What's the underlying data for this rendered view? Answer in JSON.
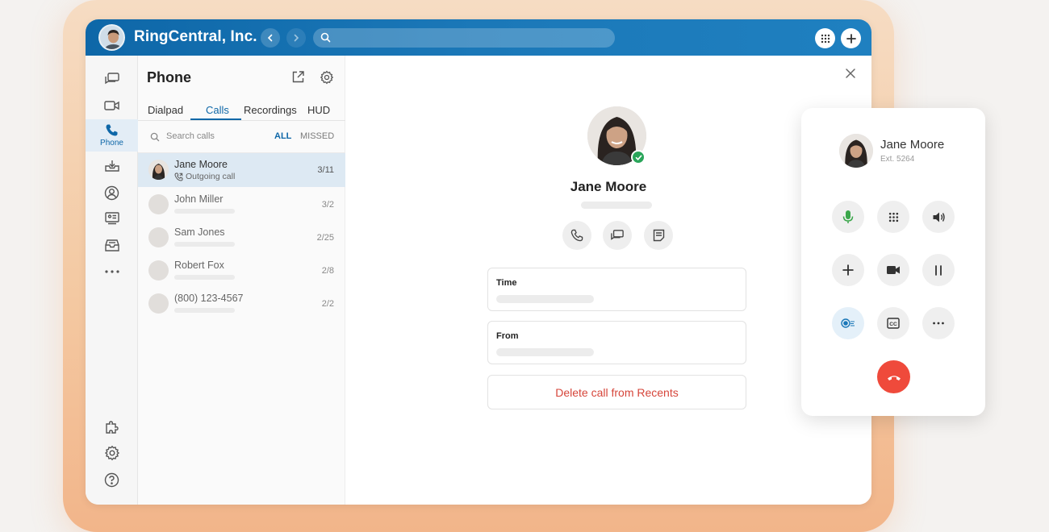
{
  "header": {
    "org_name": "RingCentral, Inc.",
    "search_placeholder": ""
  },
  "rail": {
    "items": [
      {
        "icon": "messages-icon"
      },
      {
        "icon": "video-icon"
      },
      {
        "icon": "phone-icon",
        "label": "Phone",
        "active": true
      },
      {
        "icon": "inbox-icon"
      },
      {
        "icon": "contacts-icon"
      },
      {
        "icon": "whiteboard-icon"
      },
      {
        "icon": "tray-icon"
      },
      {
        "icon": "more-icon"
      },
      {
        "icon": "apps-icon"
      },
      {
        "icon": "settings-icon"
      },
      {
        "icon": "help-icon"
      }
    ]
  },
  "phone": {
    "title": "Phone",
    "tabs": [
      {
        "label": "Dialpad"
      },
      {
        "label": "Calls",
        "active": true
      },
      {
        "label": "Recordings"
      },
      {
        "label": "HUD"
      }
    ],
    "search_placeholder": "Search calls",
    "filters": {
      "all": "ALL",
      "missed": "MISSED"
    },
    "calls": [
      {
        "name": "Jane Moore",
        "sub": "Outgoing call",
        "date": "3/11"
      },
      {
        "name": "John Miller",
        "date": "3/2"
      },
      {
        "name": "Sam Jones",
        "date": "2/25"
      },
      {
        "name": "Robert Fox",
        "date": "2/8"
      },
      {
        "name": "(800) 123-4567",
        "date": "2/2"
      }
    ]
  },
  "detail": {
    "name": "Jane Moore",
    "fields": [
      {
        "label": "Time"
      },
      {
        "label": "From"
      }
    ],
    "delete_label": "Delete call from Recents"
  },
  "call_card": {
    "name": "Jane Moore",
    "ext": "Ext. 5264",
    "cc_label": "CC"
  },
  "colors": {
    "brand": "#0e67a8",
    "danger": "#ef4a3b",
    "online": "#2aa55a",
    "mic": "#3aa64a"
  }
}
